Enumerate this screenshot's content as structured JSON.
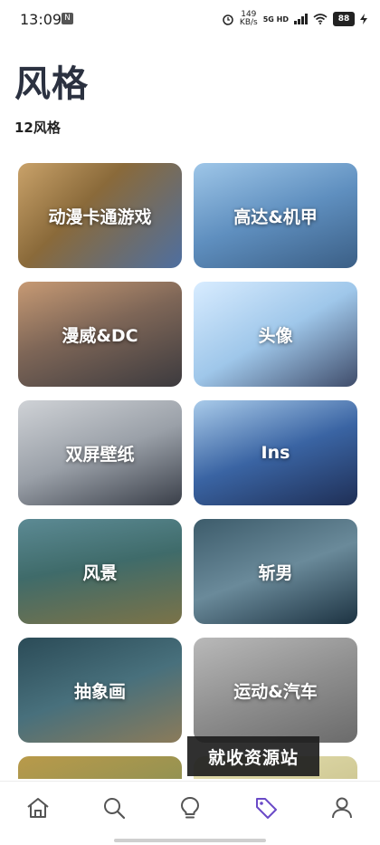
{
  "status_bar": {
    "time": "13:09",
    "notification_badge": "N",
    "net_speed_value": "149",
    "net_speed_unit": "KB/s",
    "network_type": "5G HD",
    "battery": "88"
  },
  "header": {
    "title": "风格",
    "count_label": "12风格"
  },
  "styles": [
    {
      "label": "动漫卡通游戏"
    },
    {
      "label": "高达&机甲"
    },
    {
      "label": "漫威&DC"
    },
    {
      "label": "头像"
    },
    {
      "label": "双屏壁纸"
    },
    {
      "label": "Ins"
    },
    {
      "label": "风景"
    },
    {
      "label": "斩男"
    },
    {
      "label": "抽象画"
    },
    {
      "label": "运动&汽车"
    },
    {
      "label": ""
    },
    {
      "label": ""
    }
  ],
  "overlay": {
    "watermark": "就收资源站"
  },
  "tabbar": {
    "items": [
      {
        "icon": "home-icon"
      },
      {
        "icon": "search-icon"
      },
      {
        "icon": "lightbulb-icon"
      },
      {
        "icon": "tag-icon",
        "active": true
      },
      {
        "icon": "profile-icon"
      }
    ],
    "active_color": "#6a4ac7",
    "inactive_color": "#555555"
  }
}
